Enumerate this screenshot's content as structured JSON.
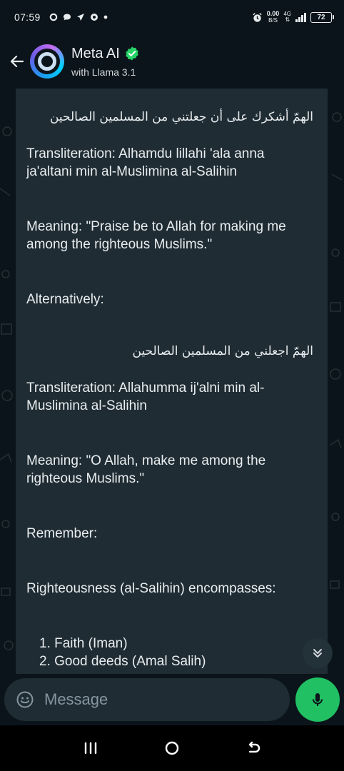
{
  "status_bar": {
    "time": "07:59",
    "net_speed_value": "0.00",
    "net_speed_unit": "B/S",
    "net_type": "4G",
    "battery": "72"
  },
  "header": {
    "name": "Meta AI",
    "subtitle": "with Llama 3.1"
  },
  "message": {
    "arabic_1": "الهمّ أشكرك على أن جعلتني من المسلمين الصالحين",
    "translit_1": "Transliteration: Alhamdu lillahi 'ala anna ja'altani min al-Muslimina al-Salihin",
    "meaning_1": "Meaning: \"Praise be to Allah for making me among the righteous Muslims.\"",
    "alternatively": "Alternatively:",
    "arabic_2": "الهمّ اجعلني من المسلمين الصالحين",
    "translit_2": "Transliteration: Allahumma ij'alni min al-Muslimina al-Salihin",
    "meaning_2": "Meaning: \"O Allah, make me among the righteous Muslims.\"",
    "remember": "Remember:",
    "righteousness": "Righteousness (al-Salihin) encompasses:",
    "list_1": "1. Faith (Iman)",
    "list_2": "2. Good deeds (Amal Salih)"
  },
  "input": {
    "placeholder": "Message"
  },
  "colors": {
    "background": "#0b141a",
    "bubble": "#1f2c34",
    "accent_green": "#21c063",
    "verified_green": "#25d366"
  }
}
